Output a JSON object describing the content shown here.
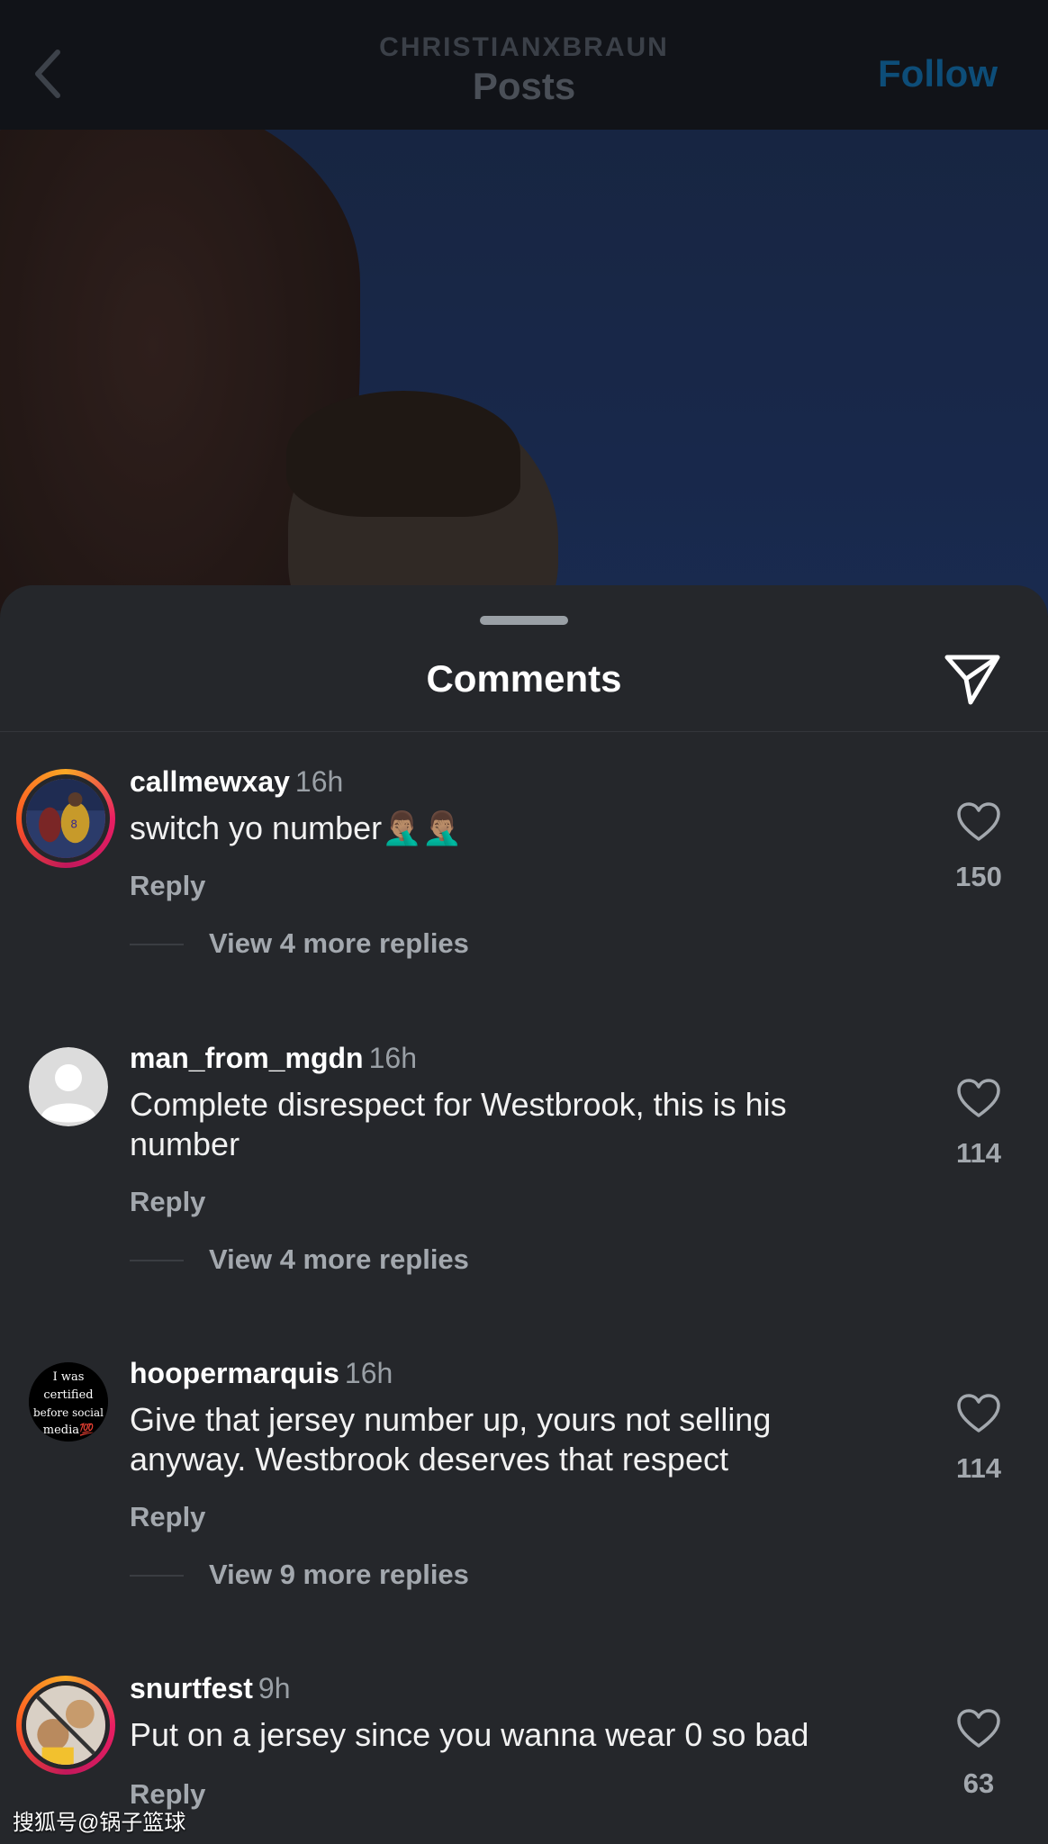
{
  "header": {
    "handle": "CHRISTIANXBRAUN",
    "title": "Posts",
    "follow_label": "Follow"
  },
  "sheet": {
    "title": "Comments"
  },
  "colors": {
    "accent_follow": "#0d4d78",
    "sheet_bg": "#25272b",
    "story_ring": "#e91e63"
  },
  "comments": [
    {
      "username": "callmewxay",
      "time": "16h",
      "text": "switch yo number🤦🏽‍♂️🤦🏽‍♂️",
      "reply_label": "Reply",
      "likes": "150",
      "more_replies": "View 4 more replies"
    },
    {
      "username": "man_from_mgdn",
      "time": "16h",
      "text": "Complete disrespect for Westbrook, this is his number",
      "reply_label": "Reply",
      "likes": "114",
      "more_replies": "View 4 more replies"
    },
    {
      "username": "hoopermarquis",
      "time": "16h",
      "text": "Give that jersey number up, yours not selling anyway. Westbrook deserves that respect",
      "reply_label": "Reply",
      "likes": "114",
      "more_replies": "View 9 more replies",
      "avatar_text": [
        "I was",
        "certified",
        "before social",
        "media💯"
      ]
    },
    {
      "username": "snurtfest",
      "time": "9h",
      "text": "Put on a jersey since you wanna wear 0 so bad",
      "reply_label": "Reply",
      "likes": "63"
    }
  ],
  "watermark": "搜狐号@锅子篮球",
  "icons": {
    "back": "chevron-left-icon",
    "share": "paper-plane-icon",
    "like": "heart-outline-icon"
  }
}
